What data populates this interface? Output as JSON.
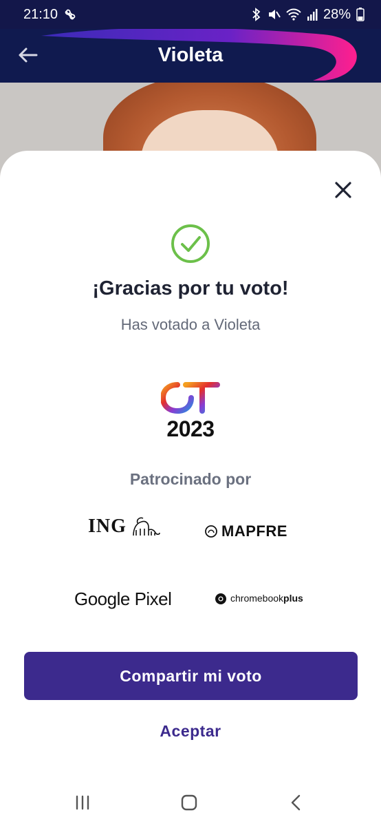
{
  "status_bar": {
    "time": "21:10",
    "battery": "28%",
    "icons": [
      "pinwheel-icon",
      "bluetooth-icon",
      "mute-icon",
      "wifi-icon",
      "signal-icon",
      "battery-icon"
    ]
  },
  "app_bar": {
    "title": "Violeta",
    "back_icon": "arrow-left-icon",
    "colors": {
      "background": "#101a4f",
      "accent": "#e0208f"
    }
  },
  "dialog": {
    "close_icon": "close-icon",
    "check_icon": "check-circle-icon",
    "check_color": "#6cc04a",
    "heading": "¡Gracias por tu voto!",
    "subtitle": "Has votado a Violeta",
    "program_logo": {
      "mark": "OT",
      "year": "2023"
    },
    "sponsored_by": "Patrocinado por",
    "sponsors": {
      "ing": "ING",
      "mapfre": "MAPFRE",
      "google_pixel": "Google Pixel",
      "chromebook_regular": "chromebook",
      "chromebook_bold": "plus"
    },
    "share_button": "Compartir mi voto",
    "accept_button": "Aceptar",
    "button_color": "#3c2a8d"
  },
  "nav_bar": {
    "icons": [
      "recent-apps-icon",
      "home-icon",
      "back-icon"
    ]
  }
}
